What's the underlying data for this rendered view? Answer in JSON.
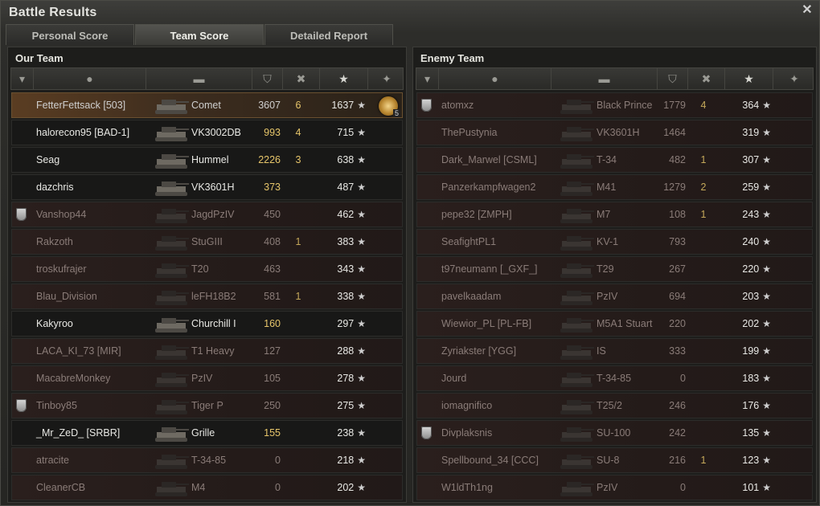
{
  "window": {
    "title": "Battle Results",
    "close_icon": "close-icon"
  },
  "tabs": [
    {
      "label": "Personal Score",
      "active": false
    },
    {
      "label": "Team Score",
      "active": true
    },
    {
      "label": "Detailed Report",
      "active": false
    }
  ],
  "header_icons": [
    "squad-icon",
    "player-icon",
    "tank-icon",
    "damage-icon",
    "kills-icon",
    "sort-chevron-icon",
    "xp-star-icon",
    "medal-icon"
  ],
  "our_team": {
    "title": "Our Team",
    "rows": [
      {
        "name": "FetterFettsack [503]",
        "tank": "Comet",
        "damage": "3607",
        "kills": "6",
        "xp": "1637",
        "status": "self",
        "squad": false,
        "medal": "5"
      },
      {
        "name": "halorecon95 [BAD-1]",
        "tank": "VK3002DB",
        "damage": "993",
        "kills": "4",
        "xp": "715",
        "status": "alive",
        "squad": false
      },
      {
        "name": "Seag",
        "tank": "Hummel",
        "damage": "2226",
        "kills": "3",
        "xp": "638",
        "status": "alive",
        "squad": false
      },
      {
        "name": "dazchris",
        "tank": "VK3601H",
        "damage": "373",
        "kills": "",
        "xp": "487",
        "status": "alive",
        "squad": false
      },
      {
        "name": "Vanshop44",
        "tank": "JagdPzIV",
        "damage": "450",
        "kills": "",
        "xp": "462",
        "status": "dead",
        "squad": true
      },
      {
        "name": "Rakzoth",
        "tank": "StuGIII",
        "damage": "408",
        "kills": "1",
        "xp": "383",
        "status": "dead",
        "squad": false
      },
      {
        "name": "troskufrajer",
        "tank": "T20",
        "damage": "463",
        "kills": "",
        "xp": "343",
        "status": "dead",
        "squad": false
      },
      {
        "name": "Blau_Division",
        "tank": "leFH18B2",
        "damage": "581",
        "kills": "1",
        "xp": "338",
        "status": "dead",
        "squad": false
      },
      {
        "name": "Kakyroo",
        "tank": "Churchill I",
        "damage": "160",
        "kills": "",
        "xp": "297",
        "status": "alive",
        "squad": false
      },
      {
        "name": "LACA_KI_73 [MIR]",
        "tank": "T1 Heavy",
        "damage": "127",
        "kills": "",
        "xp": "288",
        "status": "dead",
        "squad": false
      },
      {
        "name": "MacabreMonkey",
        "tank": "PzIV",
        "damage": "105",
        "kills": "",
        "xp": "278",
        "status": "dead",
        "squad": false
      },
      {
        "name": "Tinboy85",
        "tank": "Tiger P",
        "damage": "250",
        "kills": "",
        "xp": "275",
        "status": "dead",
        "squad": true
      },
      {
        "name": "_Mr_ZeD_ [SRBR]",
        "tank": "Grille",
        "damage": "155",
        "kills": "",
        "xp": "238",
        "status": "alive",
        "squad": false
      },
      {
        "name": "atracite",
        "tank": "T-34-85",
        "damage": "0",
        "kills": "",
        "xp": "218",
        "status": "dead",
        "squad": false
      },
      {
        "name": "CleanerCB",
        "tank": "M4",
        "damage": "0",
        "kills": "",
        "xp": "202",
        "status": "dead",
        "squad": false
      }
    ]
  },
  "enemy_team": {
    "title": "Enemy Team",
    "rows": [
      {
        "name": "atomxz",
        "tank": "Black Prince",
        "damage": "1779",
        "kills": "4",
        "xp": "364",
        "status": "dead",
        "squad": true
      },
      {
        "name": "ThePustynia",
        "tank": "VK3601H",
        "damage": "1464",
        "kills": "",
        "xp": "319",
        "status": "dead",
        "squad": false
      },
      {
        "name": "Dark_Marwel [CSML]",
        "tank": "T-34",
        "damage": "482",
        "kills": "1",
        "xp": "307",
        "status": "dead",
        "squad": false
      },
      {
        "name": "Panzerkampfwagen2",
        "tank": "M41",
        "damage": "1279",
        "kills": "2",
        "xp": "259",
        "status": "dead",
        "squad": false
      },
      {
        "name": "pepe32 [ZMPH]",
        "tank": "M7",
        "damage": "108",
        "kills": "1",
        "xp": "243",
        "status": "dead",
        "squad": false
      },
      {
        "name": "SeafightPL1",
        "tank": "KV-1",
        "damage": "793",
        "kills": "",
        "xp": "240",
        "status": "dead",
        "squad": false
      },
      {
        "name": "t97neumann [_GXF_]",
        "tank": "T29",
        "damage": "267",
        "kills": "",
        "xp": "220",
        "status": "dead",
        "squad": false
      },
      {
        "name": "pavelkaadam",
        "tank": "PzIV",
        "damage": "694",
        "kills": "",
        "xp": "203",
        "status": "dead",
        "squad": false
      },
      {
        "name": "Wiewior_PL [PL-FB]",
        "tank": "M5A1 Stuart",
        "damage": "220",
        "kills": "",
        "xp": "202",
        "status": "dead",
        "squad": false
      },
      {
        "name": "Zyriakster [YGG]",
        "tank": "IS",
        "damage": "333",
        "kills": "",
        "xp": "199",
        "status": "dead",
        "squad": false
      },
      {
        "name": "Jourd",
        "tank": "T-34-85",
        "damage": "0",
        "kills": "",
        "xp": "183",
        "status": "dead",
        "squad": false
      },
      {
        "name": "iomagnifico",
        "tank": "T25/2",
        "damage": "246",
        "kills": "",
        "xp": "176",
        "status": "dead",
        "squad": false
      },
      {
        "name": "Divplaksnis",
        "tank": "SU-100",
        "damage": "242",
        "kills": "",
        "xp": "135",
        "status": "dead",
        "squad": true
      },
      {
        "name": "Spellbound_34 [CCC]",
        "tank": "SU-8",
        "damage": "216",
        "kills": "1",
        "xp": "123",
        "status": "dead",
        "squad": false
      },
      {
        "name": "W1ldTh1ng",
        "tank": "PzIV",
        "damage": "0",
        "kills": "",
        "xp": "101",
        "status": "dead",
        "squad": false
      }
    ]
  }
}
